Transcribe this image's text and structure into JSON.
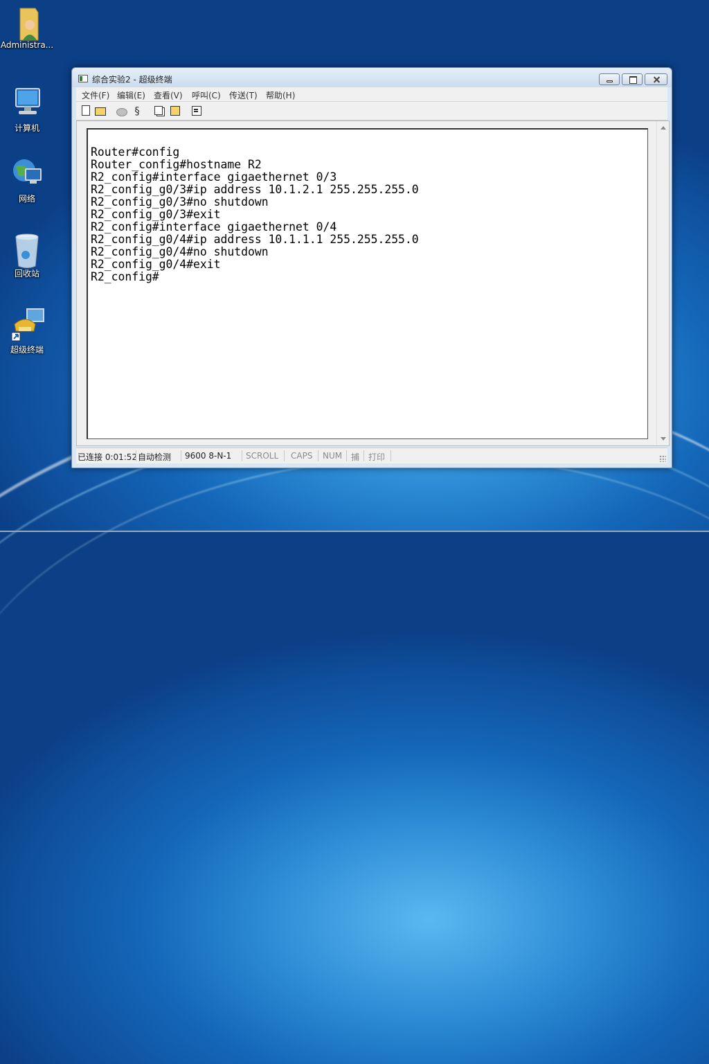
{
  "desktop": {
    "icons": [
      {
        "label": "Administra..."
      },
      {
        "label": "计算机"
      },
      {
        "label": "网络"
      },
      {
        "label": "回收站"
      },
      {
        "label": "超级终端"
      }
    ]
  },
  "window": {
    "title": "综合实验2 - 超级终端",
    "menu": [
      "文件(F)",
      "编辑(E)",
      "查看(V)",
      "呼叫(C)",
      "传送(T)",
      "帮助(H)"
    ],
    "toolbar_icons": [
      "new-icon",
      "open-icon",
      "disconnect-icon",
      "dial-icon",
      "copy-icon",
      "paste-icon",
      "properties-icon"
    ],
    "terminal_text": "Router#config\nRouter_config#hostname R2\nR2_config#interface gigaethernet 0/3\nR2_config_g0/3#ip address 10.1.2.1 255.255.255.0\nR2_config_g0/3#no shutdown\nR2_config_g0/3#exit\nR2_config#interface gigaethernet 0/4\nR2_config_g0/4#ip address 10.1.1.1 255.255.255.0\nR2_config_g0/4#no shutdown\nR2_config_g0/4#exit\nR2_config#",
    "status": {
      "connected": "已连接 0:01:52",
      "detect": "自动检测",
      "settings": "9600 8-N-1",
      "scroll": "SCROLL",
      "caps": "CAPS",
      "num": "NUM",
      "capture": "捕",
      "print": "打印"
    }
  }
}
